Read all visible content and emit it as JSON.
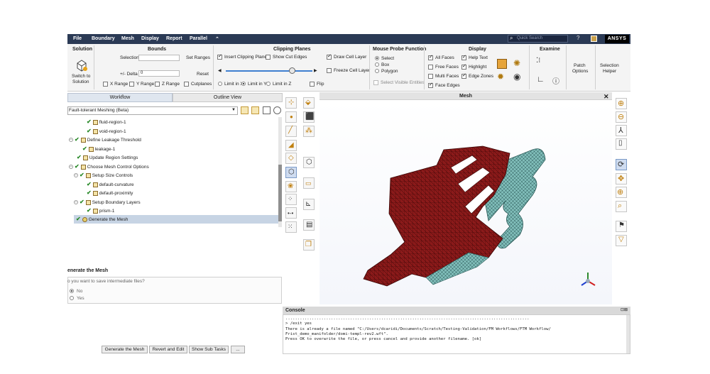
{
  "menubar": {
    "items": [
      "File",
      "Boundary",
      "Mesh",
      "Display",
      "Report",
      "Parallel"
    ],
    "search_placeholder": "Quick Search",
    "logo": "ANSYS",
    "colors": {
      "bar": "#2b3a55"
    }
  },
  "ribbon": {
    "solution": {
      "title": "Solution",
      "switch_label_1": "Switch to",
      "switch_label_2": "Solution"
    },
    "bounds": {
      "title": "Bounds",
      "selection_label": "Selection",
      "selection_value": "",
      "set_ranges": "Set Ranges",
      "delta_label": "+/- Delta",
      "delta_value": "0",
      "reset": "Reset",
      "x_range": "X Range",
      "y_range": "Y Range",
      "z_range": "Z Range",
      "cutplanes": "Cutplanes"
    },
    "clipping": {
      "title": "Clipping Planes",
      "insert": "Insert Clipping Planes",
      "show_cut_edges": "Show Cut Edges",
      "draw_cell_layer": "Draw Cell Layer",
      "freeze_cell_layer": "Freeze Cell Layer",
      "limit_x": "Limit in X",
      "limit_y": "Limit in Y",
      "limit_z": "Limit in Z",
      "flip": "Flip",
      "slider_fraction": 0.76
    },
    "mouse_probe": {
      "title": "Mouse Probe Function",
      "select": "Select",
      "box": "Box",
      "polygon": "Polygon",
      "select_visible": "Select Visible Entities"
    },
    "display": {
      "title": "Display",
      "all_faces": "All Faces",
      "free_faces": "Free Faces",
      "multi_faces": "Multi Faces",
      "face_edges": "Face Edges",
      "help_text": "Help Text",
      "highlight": "Highlight",
      "edge_zones": "Edge Zones"
    },
    "examine": {
      "title": "Examine"
    },
    "patch": {
      "line1": "Patch",
      "line2": "Options"
    },
    "selection_helper": {
      "line1": "Selection",
      "line2": "Helper"
    }
  },
  "tabs": {
    "workflow": "Workflow",
    "outline": "Outline View"
  },
  "workflow": {
    "dropdown": "Fault-tolerant Meshing (Beta)",
    "tree": [
      {
        "label": "fluid-region-1"
      },
      {
        "label": "void-region-1"
      },
      {
        "label": "Define Leakage Threshold"
      },
      {
        "label": "leakage-1"
      },
      {
        "label": "Update Region Settings"
      },
      {
        "label": "Choose Mesh Control Options"
      },
      {
        "label": "Setup Size Controls"
      },
      {
        "label": "default-curvature"
      },
      {
        "label": "default-proximity"
      },
      {
        "label": "Setup Boundary Layers"
      },
      {
        "label": "prism-1"
      },
      {
        "label": "Generate the Mesh"
      }
    ]
  },
  "generate": {
    "title": "enerate the Mesh",
    "question": "o you want to save intermediate files?",
    "no": "No",
    "yes": "Yes",
    "btn_generate": "Generate the Mesh",
    "btn_revert": "Revert and Edit",
    "btn_subtasks": "Show Sub Tasks",
    "btn_more": "..."
  },
  "graphics": {
    "title": "Mesh",
    "mesh_color": "#8b1a1a",
    "fluid_color": "#7fbcb8"
  },
  "console": {
    "title": "Console",
    "lines": [
      "......................................................................................................",
      "",
      "",
      "> /exit yes",
      "There is already a file named \"C:/Users/dcaridi/Documents/Scratch/Testing-Validation/FM Workflows/FTM Workflow/",
      "Frist_demo_manifolder/domi-templ-rev2.wft\".",
      "Press OK to overwrite the file, or press cancel and provide another filename. [ok]"
    ]
  }
}
